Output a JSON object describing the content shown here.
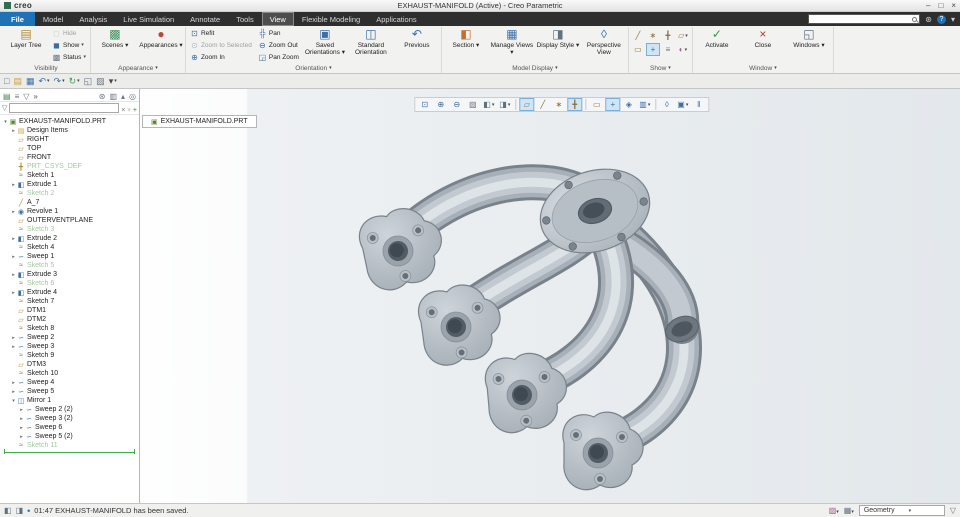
{
  "title_bar": {
    "logo": "creo",
    "title": "EXHAUST-MANIFOLD (Active) - Creo Parametric",
    "window_controls": [
      "minimize",
      "maximize",
      "close"
    ]
  },
  "menu": {
    "tabs": [
      {
        "label": "File",
        "kind": "file"
      },
      {
        "label": "Model"
      },
      {
        "label": "Analysis"
      },
      {
        "label": "Live Simulation"
      },
      {
        "label": "Annotate"
      },
      {
        "label": "Tools"
      },
      {
        "label": "View",
        "active": true
      },
      {
        "label": "Flexible Modeling"
      },
      {
        "label": "Applications"
      }
    ],
    "search": {
      "value": "",
      "placeholder": ""
    },
    "right_icons": [
      "gear",
      "help",
      "chevron-down"
    ]
  },
  "ribbon": {
    "groups": [
      {
        "label": "Visibility",
        "arrow": false,
        "items": [
          {
            "type": "big",
            "icon": "layer-tree",
            "label": "Layer Tree"
          },
          {
            "type": "stack",
            "items": [
              {
                "icon": "hide",
                "label": "Hide",
                "disabled": true
              },
              {
                "icon": "show",
                "label": "Show",
                "arrow": true
              },
              {
                "icon": "status",
                "label": "Status",
                "arrow": true
              }
            ]
          }
        ]
      },
      {
        "label": "Appearance",
        "arrow": true,
        "items": [
          {
            "type": "big",
            "icon": "scenes",
            "label": "Scenes",
            "arrow": true
          },
          {
            "type": "big",
            "icon": "appearances",
            "label": "Appearances",
            "arrow": true
          }
        ]
      },
      {
        "label": "Orientation",
        "arrow": true,
        "items": [
          {
            "type": "stack",
            "items": [
              {
                "icon": "refit",
                "label": "Refit"
              },
              {
                "icon": "zoom-selected",
                "label": "Zoom to Selected",
                "disabled": true
              },
              {
                "icon": "zoom-in",
                "label": "Zoom In"
              }
            ]
          },
          {
            "type": "stack",
            "items": [
              {
                "icon": "pan",
                "label": "Pan"
              },
              {
                "icon": "zoom-out",
                "label": "Zoom Out"
              },
              {
                "icon": "pan-zoom",
                "label": "Pan Zoom"
              }
            ]
          },
          {
            "type": "big",
            "icon": "saved-orientations",
            "label": "Saved Orientations",
            "arrow": true
          },
          {
            "type": "big",
            "icon": "standard-orientation",
            "label": "Standard Orientation"
          },
          {
            "type": "big",
            "icon": "previous",
            "label": "Previous"
          }
        ]
      },
      {
        "label": "Model Display",
        "arrow": true,
        "items": [
          {
            "type": "big",
            "icon": "section",
            "label": "Section",
            "arrow": true
          },
          {
            "type": "big",
            "icon": "manage-views",
            "label": "Manage Views",
            "arrow": true
          },
          {
            "type": "big",
            "icon": "display-style",
            "label": "Display Style",
            "arrow": true
          },
          {
            "type": "big",
            "icon": "perspective",
            "label": "Perspective View"
          }
        ]
      },
      {
        "label": "Show",
        "arrow": true,
        "items": [
          {
            "type": "grid",
            "rows": [
              [
                {
                  "icon": "axis-display"
                },
                {
                  "icon": "point-display"
                },
                {
                  "icon": "csys-display"
                },
                {
                  "icon": "plane-display",
                  "arrow": true
                }
              ],
              [
                {
                  "icon": "annotation-display"
                },
                {
                  "icon": "spin-center",
                  "active": true
                },
                {
                  "icon": "notes-display"
                },
                {
                  "icon": "colors-display",
                  "arrow": true
                }
              ]
            ]
          }
        ]
      },
      {
        "label": "Window",
        "arrow": true,
        "items": [
          {
            "type": "big",
            "icon": "activate",
            "label": "Activate"
          },
          {
            "type": "big",
            "icon": "close-window",
            "label": "Close"
          },
          {
            "type": "big",
            "icon": "windows",
            "label": "Windows",
            "arrow": true
          }
        ]
      }
    ]
  },
  "quick_toolbar": {
    "icons": [
      {
        "icon": "new-file"
      },
      {
        "icon": "open"
      },
      {
        "icon": "save"
      },
      {
        "icon": "undo",
        "arrow": true
      },
      {
        "icon": "redo",
        "arrow": true
      },
      {
        "icon": "regenerate",
        "arrow": true
      },
      {
        "icon": "windows-small"
      },
      {
        "icon": "repaint"
      },
      {
        "icon": "customize",
        "arrow": true
      }
    ]
  },
  "navigator": {
    "header_icons": [
      {
        "icon": "model-tree"
      },
      {
        "icon": "show-list"
      },
      {
        "icon": "filter"
      },
      {
        "icon": "chevrons-right"
      },
      {
        "spacer": true
      },
      {
        "icon": "settings"
      },
      {
        "icon": "columns"
      },
      {
        "icon": "collapse-all"
      },
      {
        "icon": "pin"
      }
    ],
    "search": {
      "value": "",
      "placeholder": ""
    },
    "search_buttons": [
      {
        "icon": "clear"
      },
      {
        "icon": "chevron-down"
      },
      {
        "icon": "add"
      }
    ],
    "tree": [
      {
        "label": "EXHAUST-MANIFOLD.PRT",
        "icon": "part",
        "indent": 0,
        "arrow": "open"
      },
      {
        "label": "Design Items",
        "icon": "folder",
        "indent": 1,
        "arrow": "closed"
      },
      {
        "label": "RIGHT",
        "icon": "plane",
        "indent": 1
      },
      {
        "label": "TOP",
        "icon": "plane",
        "indent": 1
      },
      {
        "label": "FRONT",
        "icon": "plane",
        "indent": 1
      },
      {
        "label": "PRT_CSYS_DEF",
        "icon": "csys",
        "indent": 1,
        "pale": true
      },
      {
        "label": "Sketch 1",
        "icon": "sketch",
        "indent": 1
      },
      {
        "label": "Extrude 1",
        "icon": "extrude",
        "indent": 1,
        "arrow": "closed"
      },
      {
        "label": "Sketch 2",
        "icon": "sketch",
        "indent": 1,
        "pale": true
      },
      {
        "label": "A_7",
        "icon": "axis",
        "indent": 1
      },
      {
        "label": "Revolve 1",
        "icon": "revolve",
        "indent": 1,
        "arrow": "closed"
      },
      {
        "label": "OUTERVENTPLANE",
        "icon": "plane",
        "indent": 1
      },
      {
        "label": "Sketch 3",
        "icon": "sketch",
        "indent": 1,
        "pale": true
      },
      {
        "label": "Extrude 2",
        "icon": "extrude",
        "indent": 1,
        "arrow": "closed"
      },
      {
        "label": "Sketch 4",
        "icon": "sketch",
        "indent": 1
      },
      {
        "label": "Sweep 1",
        "icon": "sweep",
        "indent": 1,
        "arrow": "closed"
      },
      {
        "label": "Sketch 5",
        "icon": "sketch",
        "indent": 1,
        "pale": true
      },
      {
        "label": "Extrude 3",
        "icon": "extrude",
        "indent": 1,
        "arrow": "closed"
      },
      {
        "label": "Sketch 6",
        "icon": "sketch",
        "indent": 1,
        "pale": true
      },
      {
        "label": "Extrude 4",
        "icon": "extrude",
        "indent": 1,
        "arrow": "closed"
      },
      {
        "label": "Sketch 7",
        "icon": "sketch",
        "indent": 1
      },
      {
        "label": "DTM1",
        "icon": "plane",
        "indent": 1
      },
      {
        "label": "DTM2",
        "icon": "plane",
        "indent": 1
      },
      {
        "label": "Sketch 8",
        "icon": "sketch",
        "indent": 1
      },
      {
        "label": "Sweep 2",
        "icon": "sweep",
        "indent": 1,
        "arrow": "closed"
      },
      {
        "label": "Sweep 3",
        "icon": "sweep",
        "indent": 1,
        "arrow": "closed"
      },
      {
        "label": "Sketch 9",
        "icon": "sketch",
        "indent": 1
      },
      {
        "label": "DTM3",
        "icon": "plane",
        "indent": 1
      },
      {
        "label": "Sketch 10",
        "icon": "sketch",
        "indent": 1
      },
      {
        "label": "Sweep 4",
        "icon": "sweep",
        "indent": 1,
        "arrow": "closed"
      },
      {
        "label": "Sweep 5",
        "icon": "sweep",
        "indent": 1,
        "arrow": "closed"
      },
      {
        "label": "Mirror 1",
        "icon": "mirror",
        "indent": 1,
        "arrow": "open"
      },
      {
        "label": "Sweep 2 (2)",
        "icon": "sweep",
        "indent": 2,
        "arrow": "closed"
      },
      {
        "label": "Sweep 3 (2)",
        "icon": "sweep",
        "indent": 2,
        "arrow": "closed"
      },
      {
        "label": "Sweep 6",
        "icon": "sweep",
        "indent": 2,
        "arrow": "closed"
      },
      {
        "label": "Sweep 5 (2)",
        "icon": "sweep",
        "indent": 2,
        "arrow": "closed"
      },
      {
        "label": "Sketch 11",
        "icon": "sketch",
        "indent": 1,
        "pale": true
      }
    ],
    "insert_marker": true
  },
  "graphics": {
    "doc_tab": {
      "label": "EXHAUST-MANIFOLD.PRT"
    },
    "toolbar": [
      {
        "icon": "refit"
      },
      {
        "icon": "zoom-in"
      },
      {
        "icon": "zoom-out"
      },
      {
        "icon": "repaint"
      },
      {
        "icon": "shading-with-edges",
        "arrow": true
      },
      {
        "icon": "display-style",
        "arrow": true
      },
      {
        "sep": true
      },
      {
        "icon": "plane-display",
        "active": true
      },
      {
        "icon": "axis-display"
      },
      {
        "icon": "point-display"
      },
      {
        "icon": "csys-display",
        "active": true
      },
      {
        "sep": true
      },
      {
        "icon": "annotation-display"
      },
      {
        "icon": "spin-center",
        "active": true
      },
      {
        "icon": "3d-dragger"
      },
      {
        "icon": "view-manager",
        "arrow": true
      },
      {
        "sep": true
      },
      {
        "icon": "perspective"
      },
      {
        "icon": "saved-orientations",
        "arrow": true
      },
      {
        "icon": "pause"
      }
    ]
  },
  "status_bar": {
    "left_icons": [
      {
        "icon": "navigator-toggle"
      },
      {
        "icon": "browser-toggle"
      }
    ],
    "message_bullet": "•",
    "message": "01:47 EXHAUST-MANIFOLD has been saved.",
    "right_icons": [
      {
        "icon": "appearance-brush",
        "arrow": true
      },
      {
        "icon": "grid-snap",
        "arrow": true
      }
    ],
    "filter": {
      "label": "Geometry",
      "arrow": true
    }
  },
  "colors": {
    "file_tab": "#1f72b5",
    "active_toggle": "#cfe4f5",
    "suppressed_text": "#a3c6a3",
    "insert_line": "#3fae49"
  }
}
